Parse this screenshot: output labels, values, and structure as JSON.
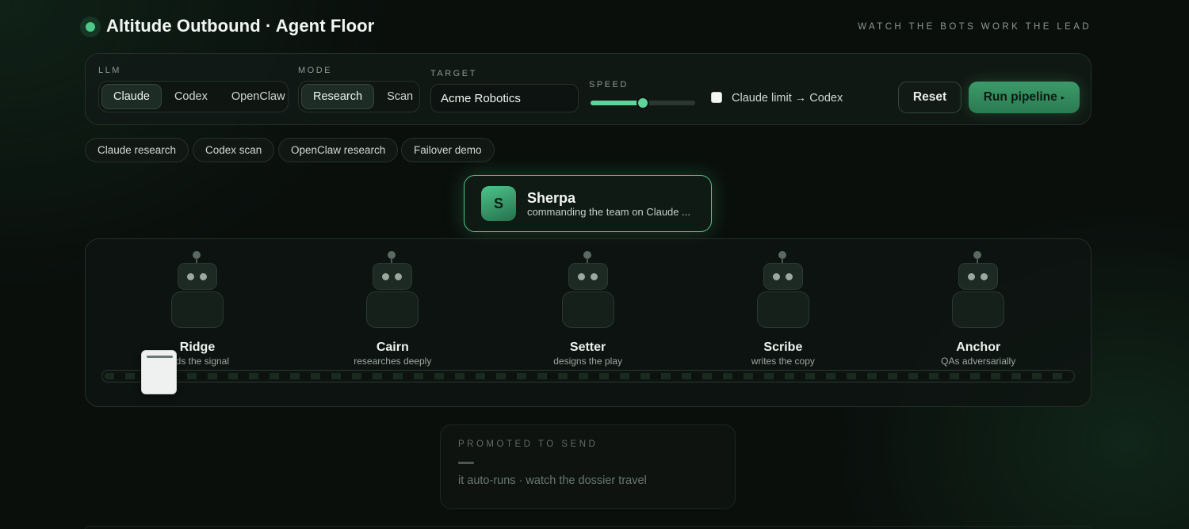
{
  "header": {
    "title": "Altitude Outbound · Agent Floor",
    "tagline": "WATCH THE BOTS WORK THE LEAD"
  },
  "controls": {
    "llm": {
      "label": "LLM",
      "options": [
        "Claude",
        "Codex",
        "OpenClaw"
      ],
      "selected": "Claude"
    },
    "mode": {
      "label": "MODE",
      "options": [
        "Research",
        "Scan"
      ],
      "selected": "Research"
    },
    "target": {
      "label": "TARGET",
      "value": "Acme Robotics"
    },
    "speed": {
      "label": "SPEED",
      "value": 0.5
    },
    "failover": {
      "label": "Claude limit → Codex",
      "checked": false
    },
    "reset_label": "Reset",
    "run_label": "Run pipeline",
    "run_caret": "▸"
  },
  "presets": [
    "Claude research",
    "Codex scan",
    "OpenClaw research",
    "Failover demo"
  ],
  "sherpa": {
    "initial": "S",
    "name": "Sherpa",
    "status": "commanding the team on Claude ..."
  },
  "bots": [
    {
      "name": "Ridge",
      "role": "finds the signal"
    },
    {
      "name": "Cairn",
      "role": "researches deeply"
    },
    {
      "name": "Setter",
      "role": "designs the play"
    },
    {
      "name": "Scribe",
      "role": "writes the copy"
    },
    {
      "name": "Anchor",
      "role": "QAs adversarially"
    }
  ],
  "promoted": {
    "label": "PROMOTED TO SEND",
    "value": "—",
    "note": "it auto-runs · watch the dossier travel"
  },
  "colors": {
    "accent": "#4cc98a",
    "background": "#0a0f0c"
  }
}
